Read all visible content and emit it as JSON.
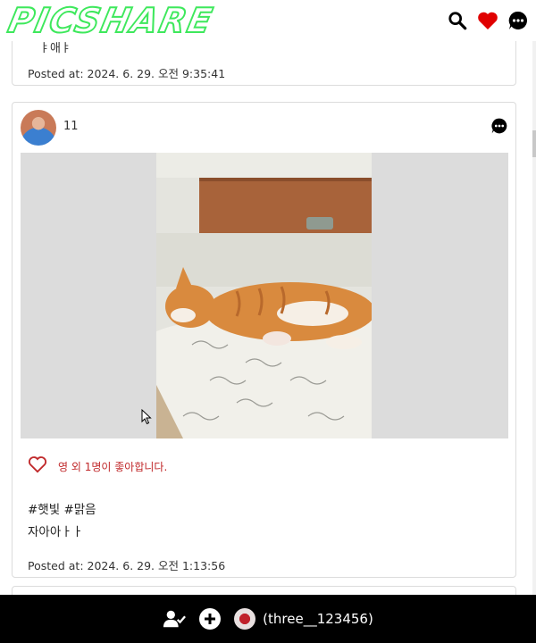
{
  "header": {
    "logo_text": "PICSHARE",
    "icons": [
      "search-icon",
      "heart-icon",
      "chat-icon"
    ]
  },
  "feed": {
    "top_post": {
      "partial_caption": "ㅑ애ㅑ",
      "posted_at": "Posted at: 2024. 6. 29. 오전 9:35:41"
    },
    "main_post": {
      "username": "11",
      "like_text": "영 외 1명이 좋아합니다.",
      "hashtags": "#햇빛 #맑음",
      "caption": "자아아ㅏㅏ",
      "posted_at": "Posted at: 2024. 6. 29. 오전 1:13:56"
    }
  },
  "bottom_bar": {
    "icons": [
      "user-check-icon",
      "add-circle-icon"
    ],
    "profile_name": "(three__123456)"
  },
  "colors": {
    "logo": "#3ee85c",
    "like": "#c0282a",
    "heart_header": "#e00000",
    "bottom_bar": "#000000"
  }
}
